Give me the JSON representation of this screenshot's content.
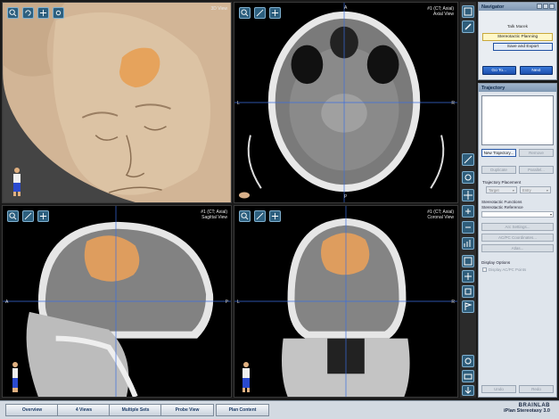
{
  "viewports": {
    "three_d": {
      "label_line1": "3D View"
    },
    "axial": {
      "label_line1": "#1 (CT; Axial)",
      "label_line2": "Axial View",
      "orient_top": "A",
      "orient_left": "L",
      "orient_right": "R",
      "orient_bottom": "P"
    },
    "sagittal": {
      "label_line1": "#1 (CT; Axial)",
      "label_line2": "Sagittal View",
      "orient_left": "A",
      "orient_right": "P"
    },
    "coronal": {
      "label_line1": "#1 (CT; Axial)",
      "label_line2": "Coronal View",
      "orient_left": "L",
      "orient_right": "R"
    }
  },
  "navigator": {
    "title": "Navigator",
    "step_label": "Talk Marek",
    "current_step": "Stereotactic Planning",
    "next_step": "Save and Export",
    "goto_button": "Go To...",
    "next_button": "Next"
  },
  "trajectory": {
    "title": "Trajectory",
    "new_button": "New Trajectory...",
    "remove_button": "Remove",
    "duplicate_button": "Duplicate",
    "parallel_button": "Parallel...",
    "placement_label": "Trajectory Placement",
    "target_dropdown": "Target",
    "entry_dropdown": "Entry",
    "functions_label": "Stereotactic Functions",
    "reference_label": "Stereotactic Reference",
    "arc_settings_button": "Arc Settings...",
    "acpc_button": "AC/PC Coordinates...",
    "atlas_button": "Atlas...",
    "display_label": "Display Options",
    "display_acpc": "Display AC/PC Points",
    "undo_button": "Undo",
    "redo_button": "Redo"
  },
  "tabs": [
    "Overview",
    "4 Views",
    "Multiple Sets",
    "Probe View",
    "Plan Content"
  ],
  "brand": {
    "name": "BRAINLAB",
    "product": "iPlan Stereotaxy 3.0"
  },
  "colors": {
    "accent": "#2a5cb0",
    "tumor": "#e8a05a",
    "skin": "#d9bfa0"
  }
}
